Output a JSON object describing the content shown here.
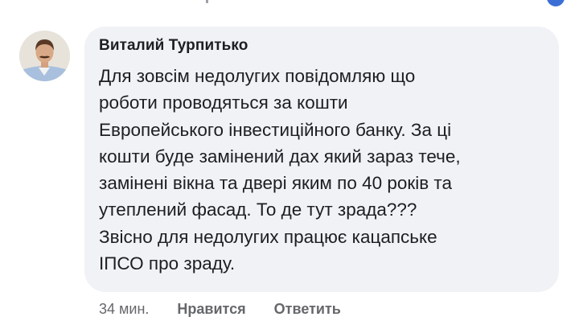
{
  "comment": {
    "author": "Виталий Турпитько",
    "lines": [
      "Для зовсім недолугих повідомляю що",
      "роботи проводяться за кошти",
      "Европейського інвестиційного банку. За ці",
      "кошти буде замінений дах який зараз тече,",
      "замінені вікна та двері яким по 40 років та",
      "утеплений фасад. То де тут зрада???",
      "Звісно для недолугих працює кацапське",
      "ІПСО про зраду."
    ],
    "time": "34 мин.",
    "like_label": "Нравится",
    "reply_label": "Ответить"
  },
  "icons": {
    "avatar": "profile-photo",
    "top_badge": "notification-badge"
  },
  "colors": {
    "bubble": "#f0f2f5",
    "text": "#1c1e21",
    "meta": "#65676b"
  }
}
